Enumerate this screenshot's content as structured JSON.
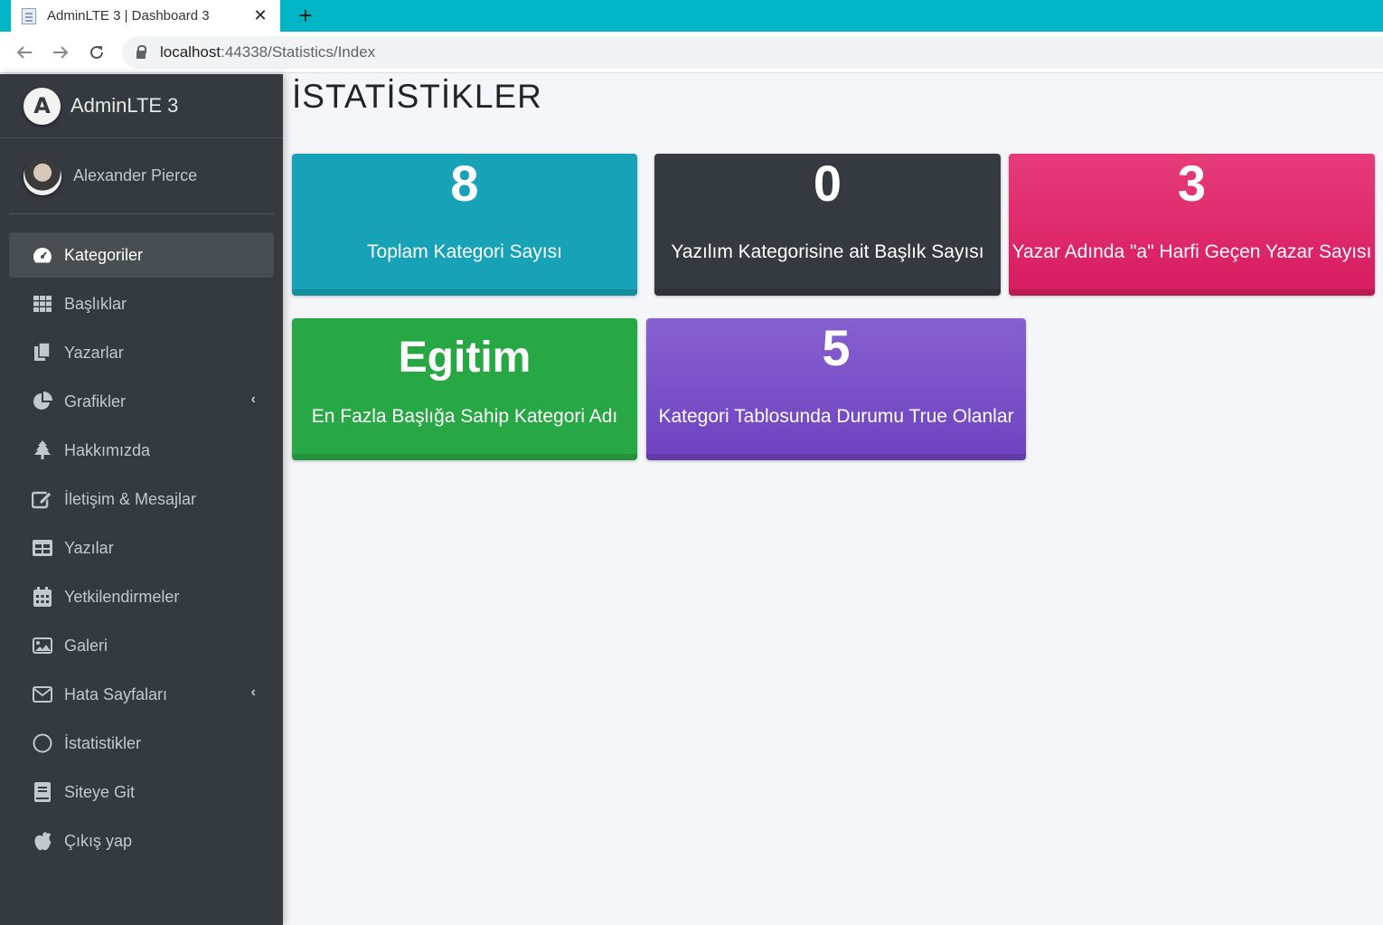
{
  "browser": {
    "tab_title": "AdminLTE 3 | Dashboard 3",
    "close_glyph": "✕",
    "newtab_glyph": "+",
    "url_host": "localhost",
    "url_rest": ":44338/Statistics/Index"
  },
  "sidebar": {
    "brand": "AdminLTE 3",
    "brand_logo_letter": "A",
    "user_name": "Alexander Pierce",
    "items": [
      {
        "label": "Kategoriler",
        "icon": "tachometer-icon",
        "active": true
      },
      {
        "label": "Başlıklar",
        "icon": "grid-icon"
      },
      {
        "label": "Yazarlar",
        "icon": "copy-icon"
      },
      {
        "label": "Grafikler",
        "icon": "pie-chart-icon",
        "has_submenu": true
      },
      {
        "label": "Hakkımızda",
        "icon": "tree-icon"
      },
      {
        "label": "İletişim & Mesajlar",
        "icon": "edit-icon"
      },
      {
        "label": "Yazılar",
        "icon": "table-icon"
      },
      {
        "label": "Yetkilendirmeler",
        "icon": "calendar-icon"
      },
      {
        "label": "Galeri",
        "icon": "image-icon"
      },
      {
        "label": "Hata Sayfaları",
        "icon": "envelope-icon",
        "has_submenu": true
      },
      {
        "label": "İstatistikler",
        "icon": "circle-icon"
      },
      {
        "label": "Siteye Git",
        "icon": "book-icon"
      },
      {
        "label": "Çıkış yap",
        "icon": "apple-icon"
      }
    ]
  },
  "content": {
    "title": "İSTATİSTİKLER",
    "boxes": [
      {
        "value": "8",
        "label": "Toplam Kategori Sayısı",
        "color": "#17a2b8"
      },
      {
        "value": "0",
        "label": "Yazılım Kategorisine ait Başlık Sayısı",
        "color": "#343a40"
      },
      {
        "value": "3",
        "label": "Yazar Adında \"a\" Harfi Geçen Yazar Sayısı",
        "color": "#e83e8c"
      },
      {
        "value": "Egitim",
        "label": "En Fazla Başlığa Sahip Kategori Adı",
        "color": "#28a745"
      },
      {
        "value": "5",
        "label": "Kategori Tablosunda Durumu True Olanlar",
        "color": "#6f42c1"
      }
    ]
  }
}
